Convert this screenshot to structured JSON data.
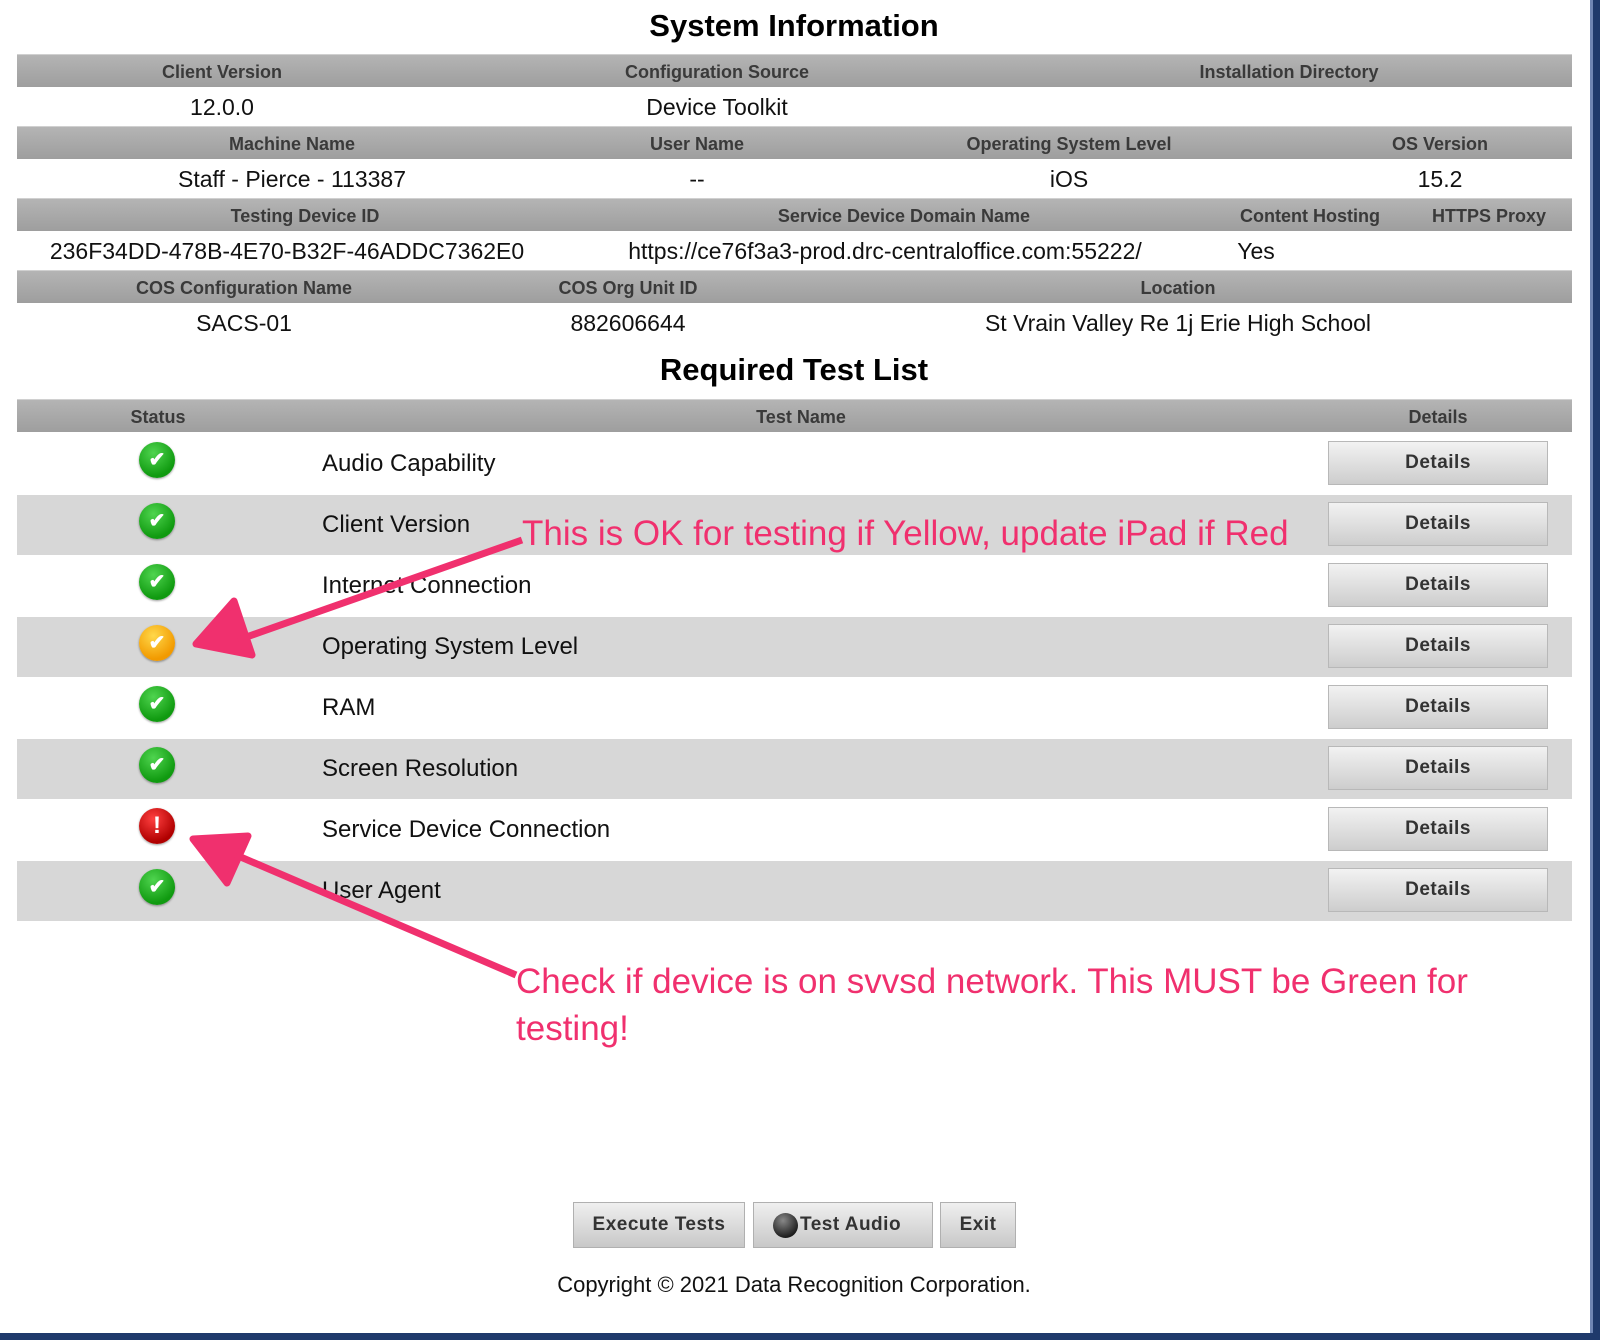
{
  "system_info": {
    "title": "System Information",
    "group1": {
      "headers": [
        "Client Version",
        "Configuration Source",
        "Installation Directory"
      ],
      "values": [
        "12.0.0",
        "Device Toolkit",
        ""
      ]
    },
    "group2": {
      "headers": [
        "Machine Name",
        "User Name",
        "Operating System Level",
        "OS Version"
      ],
      "values": [
        "Staff - Pierce - 113387",
        "--",
        "iOS",
        "15.2"
      ]
    },
    "group3": {
      "headers": [
        "Testing Device ID",
        "Service Device Domain Name",
        "Content Hosting",
        "HTTPS Proxy"
      ],
      "values": [
        "236F34DD-478B-4E70-B32F-46ADDC7362E0",
        "https://ce76f3a3-prod.drc-centraloffice.com:55222/",
        "Yes",
        ""
      ]
    },
    "group4": {
      "headers": [
        "COS Configuration Name",
        "COS Org Unit ID",
        "Location"
      ],
      "values": [
        "SACS-01",
        "882606644",
        "St Vrain Valley Re 1j Erie High School"
      ]
    }
  },
  "tests": {
    "title": "Required Test List",
    "headers": [
      "Status",
      "Test Name",
      "Details"
    ],
    "details_label": "Details",
    "status_colors": {
      "pass": "#109a10",
      "warn": "#f29a00",
      "fail": "#b00000"
    },
    "rows": [
      {
        "name": "Audio Capability",
        "status": "pass"
      },
      {
        "name": "Client Version",
        "status": "pass"
      },
      {
        "name": "Internet Connection",
        "status": "pass"
      },
      {
        "name": "Operating System Level",
        "status": "warn"
      },
      {
        "name": "RAM",
        "status": "pass"
      },
      {
        "name": "Screen Resolution",
        "status": "pass"
      },
      {
        "name": "Service Device Connection",
        "status": "fail"
      },
      {
        "name": "User Agent",
        "status": "pass"
      }
    ]
  },
  "annotations": {
    "color": "#f0306e",
    "note1": "This is OK for testing if Yellow, update iPad if Red",
    "note2": "Check if device is on svvsd network.  This MUST be Green for testing!"
  },
  "footer": {
    "execute_label": "Execute Tests",
    "audio_label": "Test Audio",
    "exit_label": "Exit",
    "copyright": "Copyright © 2021 Data Recognition Corporation."
  }
}
